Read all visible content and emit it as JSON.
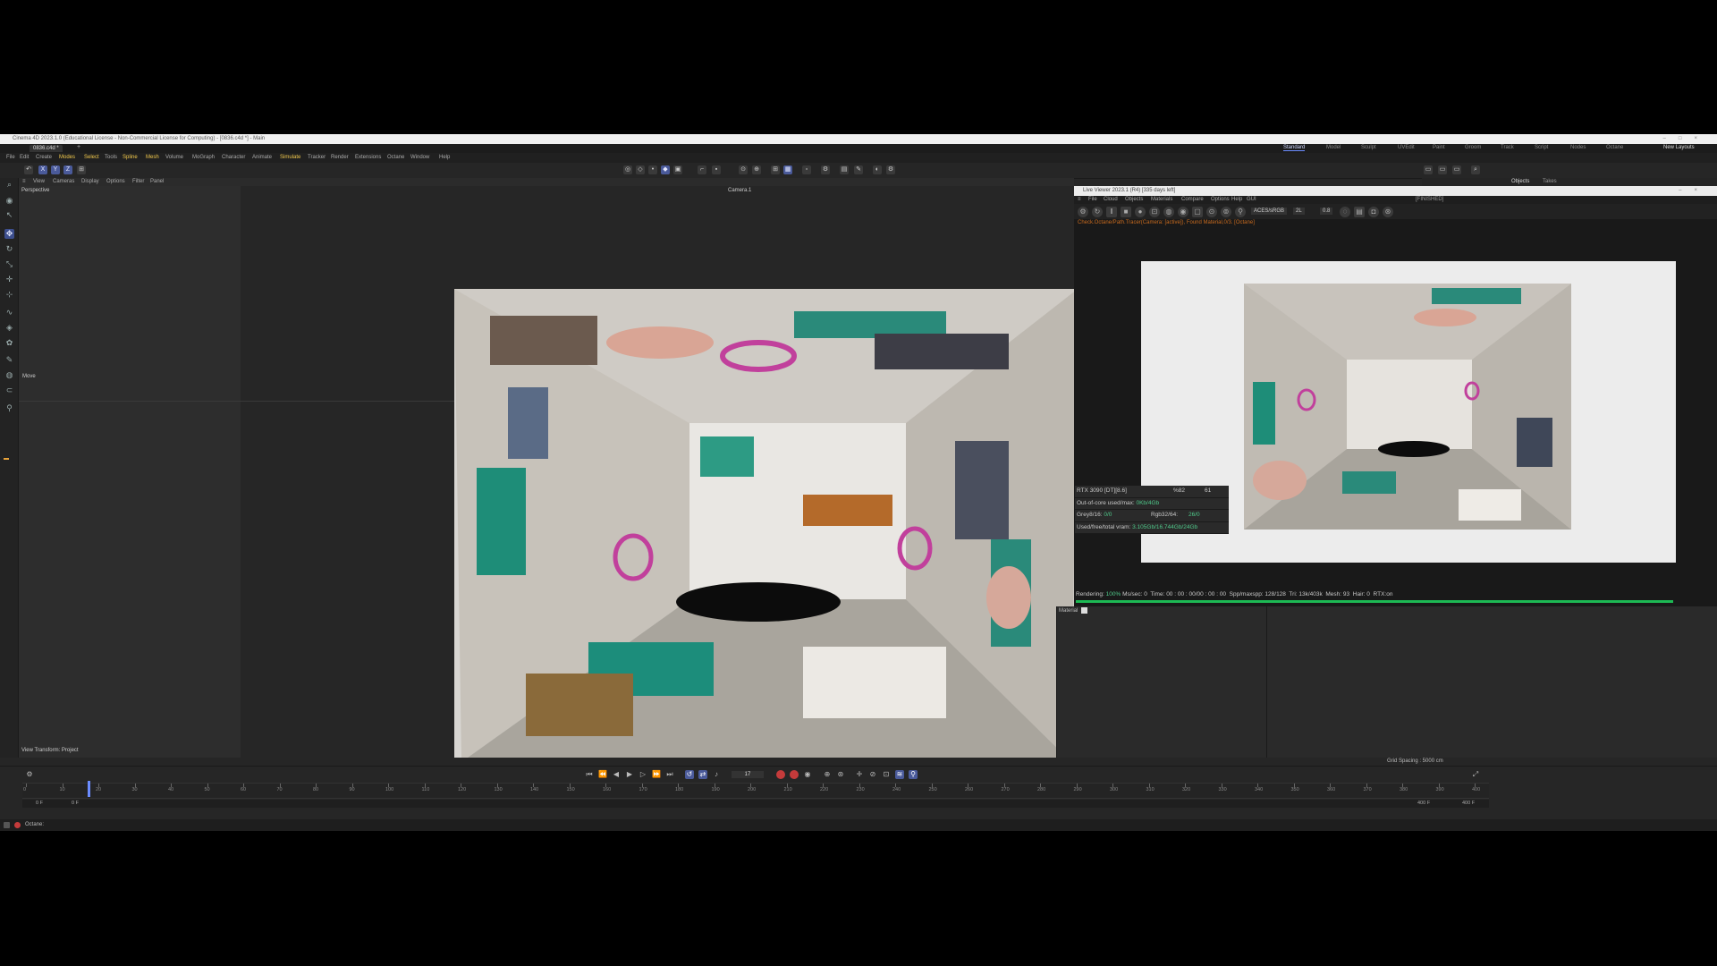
{
  "window": {
    "title": "Cinema 4D 2023.1.0 (Educational License - Non-Commercial License for Computing) - [0836.c4d *] - Main"
  },
  "doc_tab": "0836.c4d *",
  "layouts": [
    "Standard",
    "Model",
    "Sculpt",
    "UVEdit",
    "Paint",
    "Groom",
    "Track",
    "Script",
    "Nodes",
    "Octane"
  ],
  "new_layouts": "New Layouts",
  "menu": [
    "File",
    "Edit",
    "Create",
    "Modes",
    "Select",
    "Tools",
    "Spline",
    "Mesh",
    "Volume",
    "MoGraph",
    "Character",
    "Animate",
    "Simulate",
    "Tracker",
    "Render",
    "Extensions",
    "Octane",
    "Window",
    "Help"
  ],
  "viewport": {
    "menu": [
      "View",
      "Cameras",
      "Display",
      "Options",
      "Filter",
      "Panel"
    ],
    "name": "Perspective",
    "camera": "Camera.1",
    "hud_label": "Move",
    "view_transform": "View Transform: Project",
    "grid_spacing": "Grid Spacing : 5000 cm"
  },
  "side_tabs": [
    "Objects",
    "Takes"
  ],
  "live_viewer": {
    "title": "Live Viewer 2023.1 (R4) [335 days left]",
    "status": "[FINISHED]",
    "menu": [
      "File",
      "Cloud",
      "Objects",
      "Materials",
      "Compare",
      "Options",
      "Help",
      "GUI"
    ],
    "kernel": "ACES/sRGB",
    "zoom": "2L",
    "value": "0.8",
    "message": "Check.Octane/Path.Tracer(Camera: [active]), Found Material,0/3. [Octane]",
    "stats": {
      "gpu": "RTX 3090 [DT][8.6]",
      "gpu_pct": "%82",
      "gpu_temp": "61",
      "ooc_label": "Out-of-core used/max:",
      "ooc_value": "0Kb/4Gb",
      "grey_label": "Grey8/16:",
      "grey_value": "0/0",
      "rgb_label": "Rgb32/64:",
      "rgb_value": "26/0",
      "vram_label": "Used/free/total vram:",
      "vram_value": "3.105Gb/16.744Gb/24Gb"
    },
    "render_line": {
      "rendering": "Rendering:",
      "pct": "100%",
      "ms": "Ms/sec: 0",
      "time": "Time: 00 : 00 : 00/00 : 00 : 00",
      "spp": "Spp/maxspp: 128/128",
      "tri": "Tri: 13k/403k",
      "mesh": "Mesh: 93",
      "hair": "Hair: 0",
      "rtx": "RTX:on"
    },
    "progress": 1.0
  },
  "material_panel": {
    "title": "Material"
  },
  "timeline": {
    "current_frame": "17",
    "ticks": [
      "0",
      "10",
      "20",
      "30",
      "40",
      "50",
      "60",
      "70",
      "80",
      "90",
      "100",
      "110",
      "120",
      "130",
      "140",
      "150",
      "160",
      "170",
      "180",
      "190",
      "200",
      "210",
      "220",
      "230",
      "240",
      "250",
      "260",
      "270",
      "280",
      "290",
      "300",
      "310",
      "320",
      "330",
      "340",
      "350",
      "360",
      "370",
      "380",
      "390",
      "400"
    ],
    "start": "0 F",
    "start2": "0 F",
    "end": "400 F",
    "end2": "400 F",
    "playhead_frame": 17,
    "max_frame": 400
  },
  "bottom_status": "Octane:",
  "colors": {
    "accent": "#6b8cff",
    "menu_highlight": "#f2c94c",
    "progress": "#1db954",
    "stat_value": "#4fc98a",
    "record": "#c43b3b"
  }
}
